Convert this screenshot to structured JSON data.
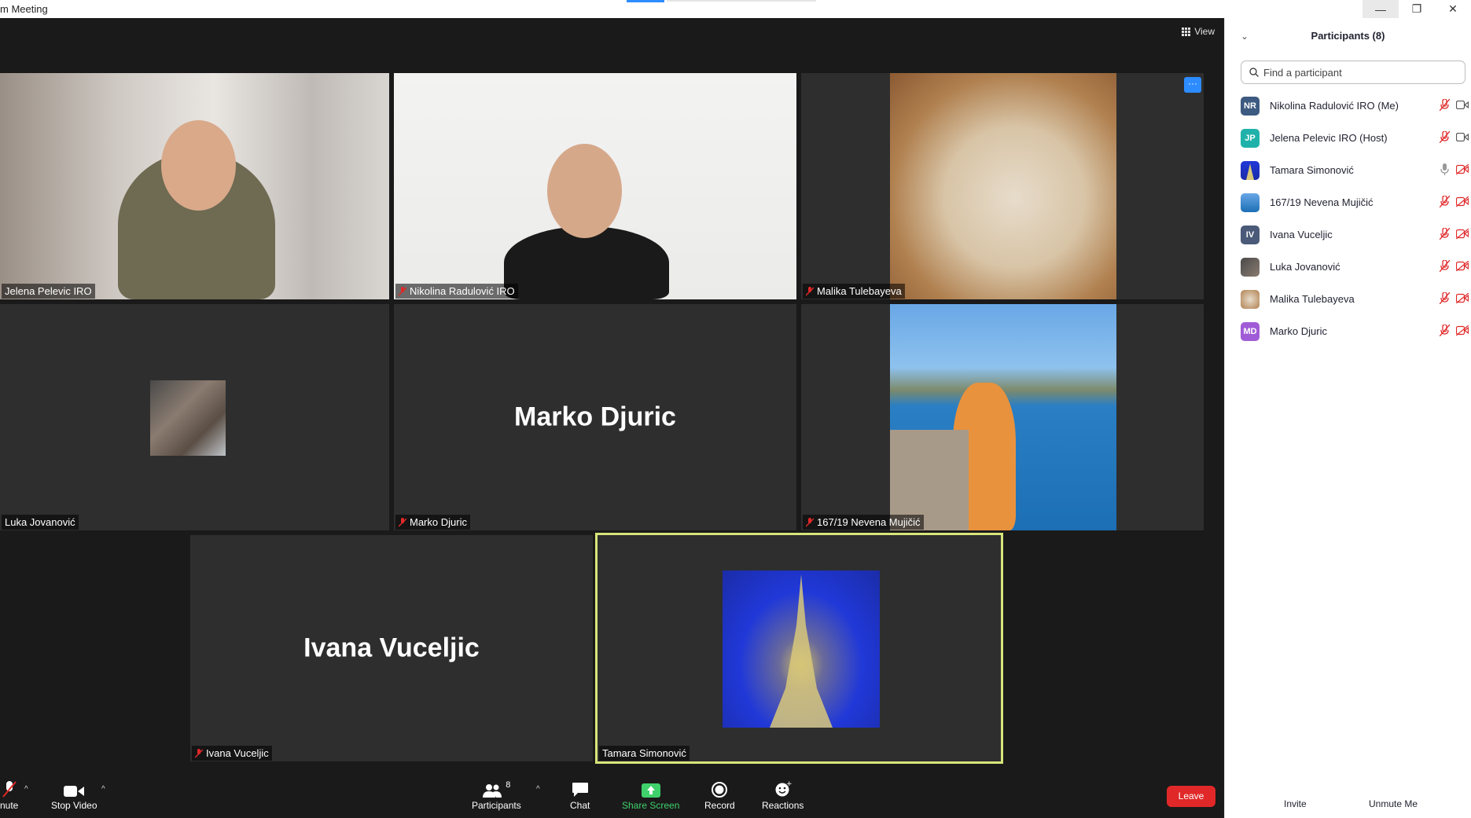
{
  "window": {
    "title": "m Meeting",
    "controls": {
      "minimize": "—",
      "restore": "❐",
      "close": "✕"
    }
  },
  "view": {
    "label": "View"
  },
  "tiles": [
    {
      "id": "jelena",
      "label": "Jelena Pelevic IRO",
      "muted": false
    },
    {
      "id": "nikolina",
      "label": "Nikolina Radulović IRO",
      "muted": true
    },
    {
      "id": "malika",
      "label": "Malika Tulebayeva",
      "muted": true
    },
    {
      "id": "luka",
      "label": "Luka Jovanović",
      "muted": false
    },
    {
      "id": "marko",
      "label": "Marko Djuric",
      "muted": true,
      "big_name": "Marko Djuric"
    },
    {
      "id": "nevena",
      "label": "167/19 Nevena Mujičić",
      "muted": true
    },
    {
      "id": "ivana",
      "label": "Ivana Vuceljic",
      "muted": true,
      "big_name": "Ivana Vuceljic"
    },
    {
      "id": "tamara",
      "label": "Tamara Simonović",
      "muted": false,
      "active_speaker": true
    }
  ],
  "more_button": "···",
  "toolbar": {
    "unmute": "nute",
    "stop_video": "Stop Video",
    "participants": "Participants",
    "participants_count": "8",
    "chat": "Chat",
    "share_screen": "Share Screen",
    "record": "Record",
    "reactions": "Reactions",
    "leave": "Leave",
    "caret": "^"
  },
  "panel": {
    "title": "Participants (8)",
    "search_placeholder": "Find a participant",
    "participants": [
      {
        "initials": "NR",
        "name": "Nikolina Radulović IRO (Me)",
        "color": "#3d5a80",
        "video": "on"
      },
      {
        "initials": "JP",
        "name": "Jelena Pelevic IRO (Host)",
        "color": "#20b2aa",
        "video": "on"
      },
      {
        "initials": "",
        "name": "Tamara Simonović",
        "color": "#1b2ca8",
        "video": "off",
        "mic": "on"
      },
      {
        "initials": "",
        "name": "167/19 Nevena Mujičić",
        "color": "#5aa0e0",
        "video": "off"
      },
      {
        "initials": "IV",
        "name": "Ivana Vuceljic",
        "color": "#4a5a78",
        "video": "off"
      },
      {
        "initials": "",
        "name": "Luka Jovanović",
        "color": "#5a4e45",
        "video": "off"
      },
      {
        "initials": "",
        "name": "Malika Tulebayeva",
        "color": "#c8a070",
        "video": "off"
      },
      {
        "initials": "MD",
        "name": "Marko Djuric",
        "color": "#a05cd6",
        "video": "off"
      }
    ],
    "invite": "Invite",
    "unmute_me": "Unmute Me"
  },
  "colors": {
    "accent": "#2d8cff",
    "leave": "#e02828",
    "share": "#3fd16b",
    "active_border": "#d8e57a",
    "muted_red": "#e02828"
  }
}
